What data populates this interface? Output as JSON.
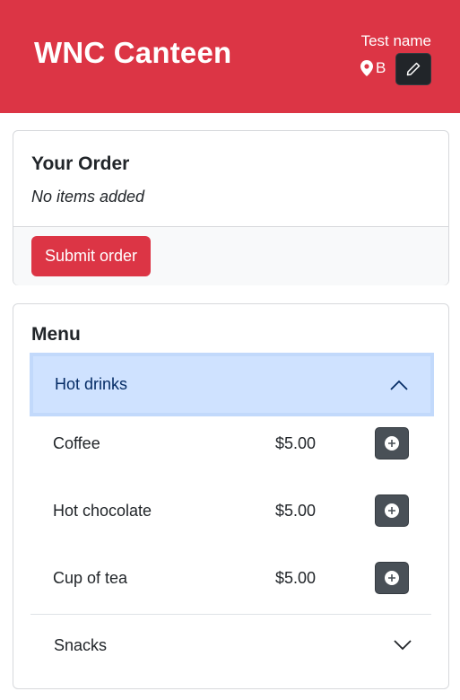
{
  "header": {
    "brand": "WNC Canteen",
    "user_name": "Test name",
    "location": "B",
    "icons": {
      "location": "map-pin-icon",
      "edit": "pencil-icon"
    }
  },
  "order": {
    "title": "Your Order",
    "empty_text": "No items added",
    "submit_label": "Submit order"
  },
  "menu": {
    "title": "Menu",
    "categories": [
      {
        "name": "Hot drinks",
        "expanded": true,
        "items": [
          {
            "name": "Coffee",
            "price": "$5.00"
          },
          {
            "name": "Hot chocolate",
            "price": "$5.00"
          },
          {
            "name": "Cup of tea",
            "price": "$5.00"
          }
        ]
      },
      {
        "name": "Snacks",
        "expanded": false
      }
    ]
  },
  "colors": {
    "primary": "#dc3545",
    "dark": "#212529",
    "accordion_active": "#cfe2ff",
    "add_button": "#495057"
  }
}
